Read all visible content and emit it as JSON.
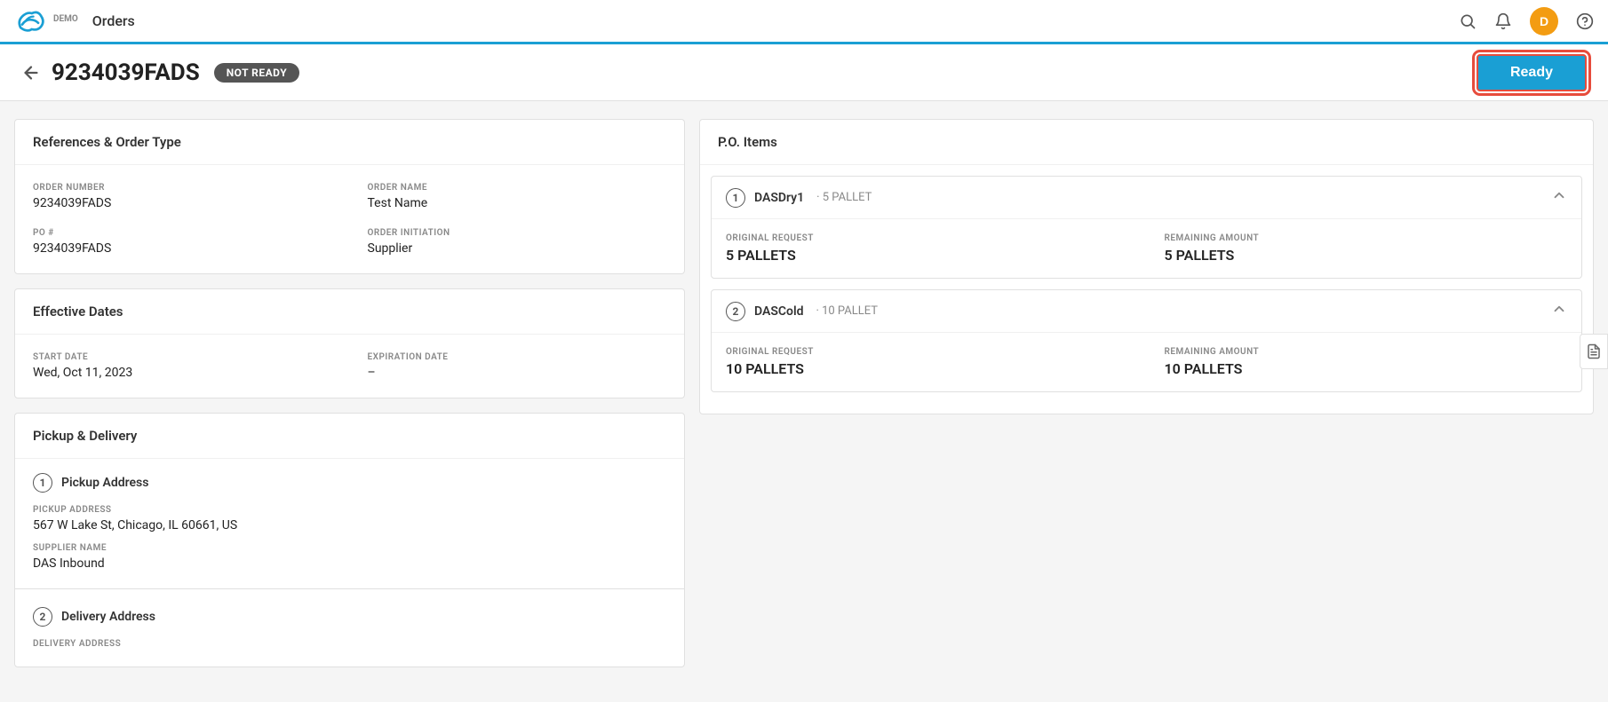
{
  "app": {
    "demo_label": "DEMO",
    "nav_title": "Orders",
    "nav_icons": {
      "search": "🔍",
      "bell": "🔔",
      "user_initial": "D",
      "help": "?"
    }
  },
  "header": {
    "order_number": "9234039FADS",
    "status_badge": "NOT READY",
    "ready_button_label": "Ready"
  },
  "references_section": {
    "title": "References & Order Type",
    "fields": [
      {
        "label": "ORDER NUMBER",
        "value": "9234039FADS"
      },
      {
        "label": "ORDER NAME",
        "value": "Test Name"
      },
      {
        "label": "PO #",
        "value": "9234039FADS"
      },
      {
        "label": "ORDER INITIATION",
        "value": "Supplier"
      }
    ]
  },
  "effective_dates_section": {
    "title": "Effective Dates",
    "fields": [
      {
        "label": "START DATE",
        "value": "Wed, Oct 11, 2023"
      },
      {
        "label": "EXPIRATION DATE",
        "value": "–"
      }
    ]
  },
  "pickup_delivery_section": {
    "title": "Pickup & Delivery",
    "pickup": {
      "number": "1",
      "title": "Pickup Address",
      "fields": [
        {
          "label": "PICKUP ADDRESS",
          "value": "567 W Lake St, Chicago, IL 60661, US"
        },
        {
          "label": "SUPPLIER NAME",
          "value": "DAS Inbound"
        }
      ]
    },
    "delivery": {
      "number": "2",
      "title": "Delivery Address",
      "fields": [
        {
          "label": "DELIVERY ADDRESS",
          "value": ""
        }
      ]
    }
  },
  "po_items_section": {
    "title": "P.O. Items",
    "items": [
      {
        "number": "1",
        "name": "DASDry1",
        "subtitle": "· 5 PALLET",
        "expanded": true,
        "fields": [
          {
            "label": "ORIGINAL REQUEST",
            "value": "5 PALLETS"
          },
          {
            "label": "REMAINING AMOUNT",
            "value": "5 PALLETS"
          }
        ]
      },
      {
        "number": "2",
        "name": "DASCold",
        "subtitle": "· 10 PALLET",
        "expanded": true,
        "fields": [
          {
            "label": "ORIGINAL REQUEST",
            "value": "10 PALLETS"
          },
          {
            "label": "REMAINING AMOUNT",
            "value": "10 PALLETS"
          }
        ]
      }
    ]
  }
}
